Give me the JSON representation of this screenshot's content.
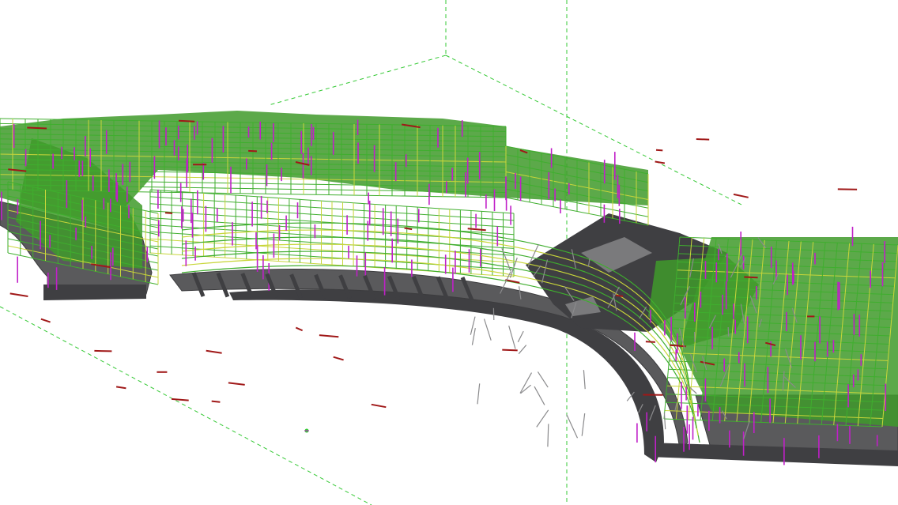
{
  "viewport": {
    "label": "",
    "background": "#ffffff"
  },
  "colors": {
    "guide_line": "#35c935",
    "structure_green": "#3fae2e",
    "structure_yellow": "#c8d63a",
    "column_magenta": "#c020c8",
    "beam_red": "#a01818",
    "slab_gray": "#5a5a5c",
    "slab_dark": "#3f3f42",
    "pipe_gray": "#8a8a8c"
  },
  "icons": {
    "cursor": "cursor-crosshair-icon"
  }
}
